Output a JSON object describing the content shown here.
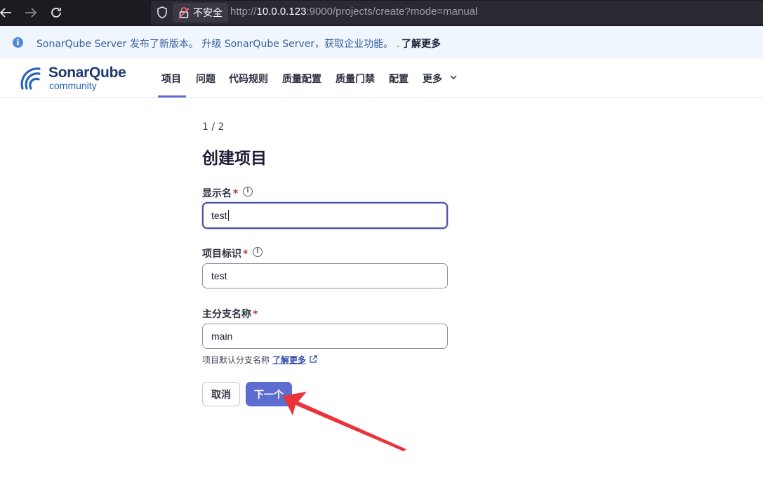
{
  "browser": {
    "security_label": "不安全",
    "url_prefix": "http://",
    "url_host": "10.0.0.123",
    "url_rest": ":9000/projects/create?mode=manual"
  },
  "banner": {
    "message": "SonarQube Server 发布了新版本。 升级 SonarQube Server，获取企业功能。 .",
    "link_label": "了解更多"
  },
  "logo": {
    "name": "SonarQube",
    "edition": "community"
  },
  "nav": {
    "items": [
      "项目",
      "问题",
      "代码规则",
      "质量配置",
      "质量门禁",
      "配置",
      "更多"
    ],
    "active": "项目"
  },
  "form": {
    "step": "1 / 2",
    "title": "创建项目",
    "display_name": {
      "label": "显示名",
      "required_mark": "*",
      "value": "test"
    },
    "project_key": {
      "label": "项目标识",
      "required_mark": "*",
      "value": "test"
    },
    "main_branch": {
      "label": "主分支名称",
      "required_mark": "*",
      "value": "main"
    },
    "hint": {
      "text": "项目默认分支名称",
      "link": "了解更多"
    },
    "cancel_label": "取消",
    "next_label": "下一个"
  },
  "colors": {
    "primary": "#5d6cd0",
    "annotation_arrow": "#e8343a",
    "banner_bg": "#eff6fd"
  }
}
